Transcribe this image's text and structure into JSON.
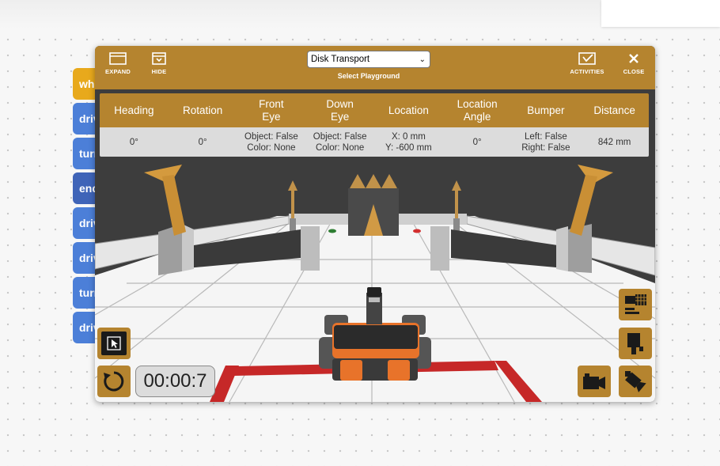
{
  "code_blocks": [
    "wh",
    "driv",
    "turn",
    "end",
    "driv",
    "driv",
    "turn",
    "driv"
  ],
  "titlebar": {
    "expand_label": "EXPAND",
    "hide_label": "HIDE",
    "playground_select": {
      "value": "Disk Transport"
    },
    "select_caption": "Select Playground",
    "activities_label": "ACTIVITIES",
    "close_label": "CLOSE"
  },
  "stats": {
    "headers": [
      "Heading",
      "Rotation",
      "Front\nEye",
      "Down\nEye",
      "Location",
      "Location\nAngle",
      "Bumper",
      "Distance"
    ],
    "values": [
      "0°",
      "0°",
      "Object: False\nColor: None",
      "Object: False\nColor: None",
      "X: 0 mm\nY: -600 mm",
      "0°",
      "Left: False\nRight: False",
      "842 mm"
    ]
  },
  "timer": "00:00:7",
  "icons": {
    "expand": "expand-icon",
    "hide": "hide-icon",
    "activities": "activities-check-icon",
    "close": "close-icon",
    "pointer": "pointer-icon",
    "reset": "reset-icon",
    "grid": "grid-view-icon",
    "person": "robot-view-icon",
    "camera": "camera-icon",
    "camera_rotate": "camera-rotate-icon"
  },
  "colors": {
    "accent": "#b5842f",
    "table_body": "#dcdcdc",
    "wall": "#3d3d3d",
    "line_red": "#c62828",
    "robot_orange": "#e8732a"
  }
}
